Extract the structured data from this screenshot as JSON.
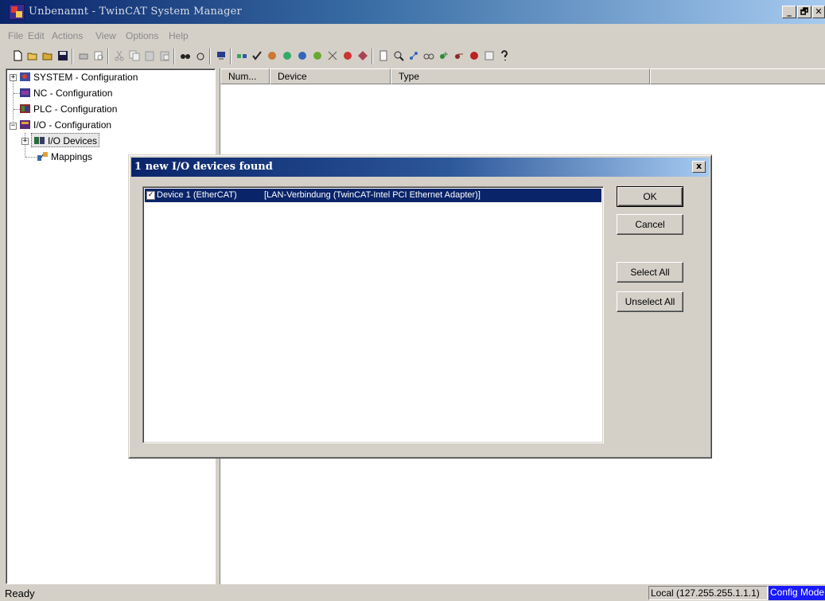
{
  "window": {
    "title": "Unbenannt - TwinCAT System Manager",
    "minimize_label": "_",
    "restore_label": "🗗",
    "close_label": "✕"
  },
  "menu": {
    "items": [
      "File",
      "Edit",
      "Actions",
      "View",
      "Options",
      "Help"
    ]
  },
  "tree": {
    "items": [
      {
        "label": "SYSTEM - Configuration",
        "icon": "system-config-icon",
        "expander": "+"
      },
      {
        "label": "NC - Configuration",
        "icon": "nc-config-icon"
      },
      {
        "label": "PLC - Configuration",
        "icon": "plc-config-icon"
      },
      {
        "label": "I/O - Configuration",
        "icon": "io-config-icon",
        "expander": "−"
      },
      {
        "label": "I/O Devices",
        "icon": "io-devices-icon",
        "expander": "+"
      },
      {
        "label": "Mappings",
        "icon": "mappings-icon"
      }
    ]
  },
  "list": {
    "columns": [
      "Num...",
      "Device",
      "Type"
    ]
  },
  "dialog": {
    "title": "1 new I/O devices found",
    "close_label": "x",
    "devices": [
      {
        "checked": true,
        "check_mark": "✓",
        "name": "Device 1 (EtherCAT)",
        "adapter": "[LAN-Verbindung (TwinCAT-Intel PCI Ethernet Adapter)]"
      }
    ],
    "buttons": {
      "ok": "OK",
      "cancel": "Cancel",
      "select_all": "Select All",
      "unselect_all": "Unselect All"
    }
  },
  "status": {
    "ready": "Ready",
    "host": "Local (127.255.255.1.1.1)",
    "mode": "Config Mode"
  },
  "colors": {
    "titlebar": "#0a246a",
    "selection": "#0a246a",
    "config_mode": "#1a1aff",
    "face": "#d4d0c8"
  }
}
